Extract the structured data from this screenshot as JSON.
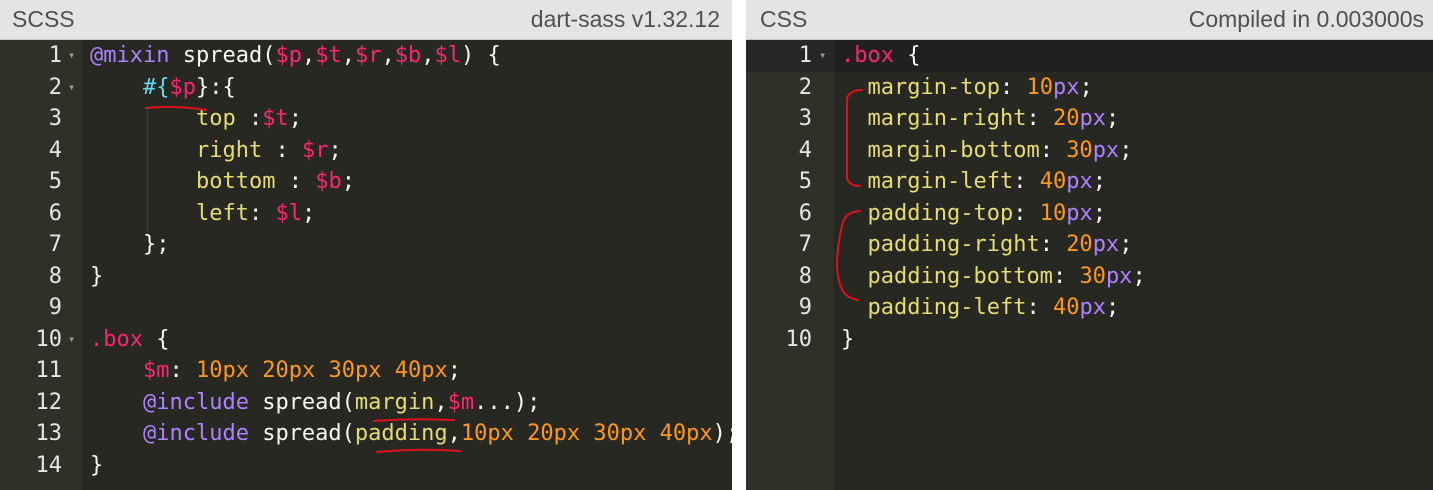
{
  "scss_pane": {
    "title": "SCSS",
    "compiler": "dart-sass v1.32.12",
    "lines": [
      {
        "n": "1",
        "fold": true,
        "text": "@mixin spread($p,$t,$r,$b,$l) {"
      },
      {
        "n": "2",
        "fold": true,
        "text": "    #{$p}:{"
      },
      {
        "n": "3",
        "fold": false,
        "text": "        top :$t;"
      },
      {
        "n": "4",
        "fold": false,
        "text": "        right : $r;"
      },
      {
        "n": "5",
        "fold": false,
        "text": "        bottom : $b;"
      },
      {
        "n": "6",
        "fold": false,
        "text": "        left: $l;"
      },
      {
        "n": "7",
        "fold": false,
        "text": "    };"
      },
      {
        "n": "8",
        "fold": false,
        "text": "}"
      },
      {
        "n": "9",
        "fold": false,
        "text": ""
      },
      {
        "n": "10",
        "fold": true,
        "text": ".box {"
      },
      {
        "n": "11",
        "fold": false,
        "text": "    $m: 10px 20px 30px 40px;"
      },
      {
        "n": "12",
        "fold": false,
        "text": "    @include spread(margin,$m...);"
      },
      {
        "n": "13",
        "fold": false,
        "text": "    @include spread(padding,10px 20px 30px 40px);"
      },
      {
        "n": "14",
        "fold": false,
        "text": "}"
      }
    ]
  },
  "css_pane": {
    "title": "CSS",
    "status": "Compiled in 0.003000s",
    "lines": [
      {
        "n": "1",
        "fold": true,
        "text": ".box {"
      },
      {
        "n": "2",
        "fold": false,
        "text": "  margin-top: 10px;"
      },
      {
        "n": "3",
        "fold": false,
        "text": "  margin-right: 20px;"
      },
      {
        "n": "4",
        "fold": false,
        "text": "  margin-bottom: 30px;"
      },
      {
        "n": "5",
        "fold": false,
        "text": "  margin-left: 40px;"
      },
      {
        "n": "6",
        "fold": false,
        "text": "  padding-top: 10px;"
      },
      {
        "n": "7",
        "fold": false,
        "text": "  padding-right: 20px;"
      },
      {
        "n": "8",
        "fold": false,
        "text": "  padding-bottom: 30px;"
      },
      {
        "n": "9",
        "fold": false,
        "text": "  padding-left: 40px;"
      },
      {
        "n": "10",
        "fold": false,
        "text": "}"
      }
    ]
  },
  "colors": {
    "editor_bg": "#272822",
    "header_bg": "#e4e4e4",
    "annotation_red": "#e0101a"
  }
}
